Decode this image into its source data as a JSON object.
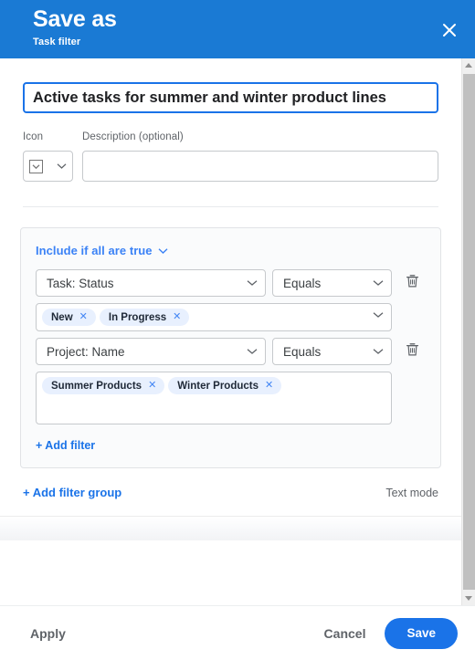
{
  "header": {
    "title": "Save as",
    "subtitle": "Task filter",
    "close_icon": "close-icon",
    "background_color": "#1a7ad4"
  },
  "form": {
    "name_value": "Active tasks for summer and winter product lines",
    "name_placeholder": "",
    "icon_label": "Icon",
    "icon_glyph": "chevron-down-icon",
    "description_label": "Description (optional)",
    "description_value": "",
    "description_placeholder": ""
  },
  "filter_group": {
    "condition_label": "Include if all are true",
    "condition_caret": "chevron-down-icon",
    "rows": [
      {
        "field": "Task: Status",
        "operator": "Equals",
        "delete_icon": "trash-icon",
        "values": [
          "New",
          "In Progress"
        ],
        "tall": false
      },
      {
        "field": "Project: Name",
        "operator": "Equals",
        "delete_icon": "trash-icon",
        "values": [
          "Summer Products",
          "Winter Products"
        ],
        "tall": true
      }
    ],
    "add_filter_label": "+ Add filter"
  },
  "group_footer": {
    "add_group_label": "+ Add filter group",
    "text_mode_label": "Text mode"
  },
  "footer": {
    "apply_label": "Apply",
    "cancel_label": "Cancel",
    "save_label": "Save",
    "save_color": "#1a73e8"
  },
  "scrollbar": {
    "up_icon": "scroll-up-arrow-icon",
    "down_icon": "scroll-down-arrow-icon"
  }
}
